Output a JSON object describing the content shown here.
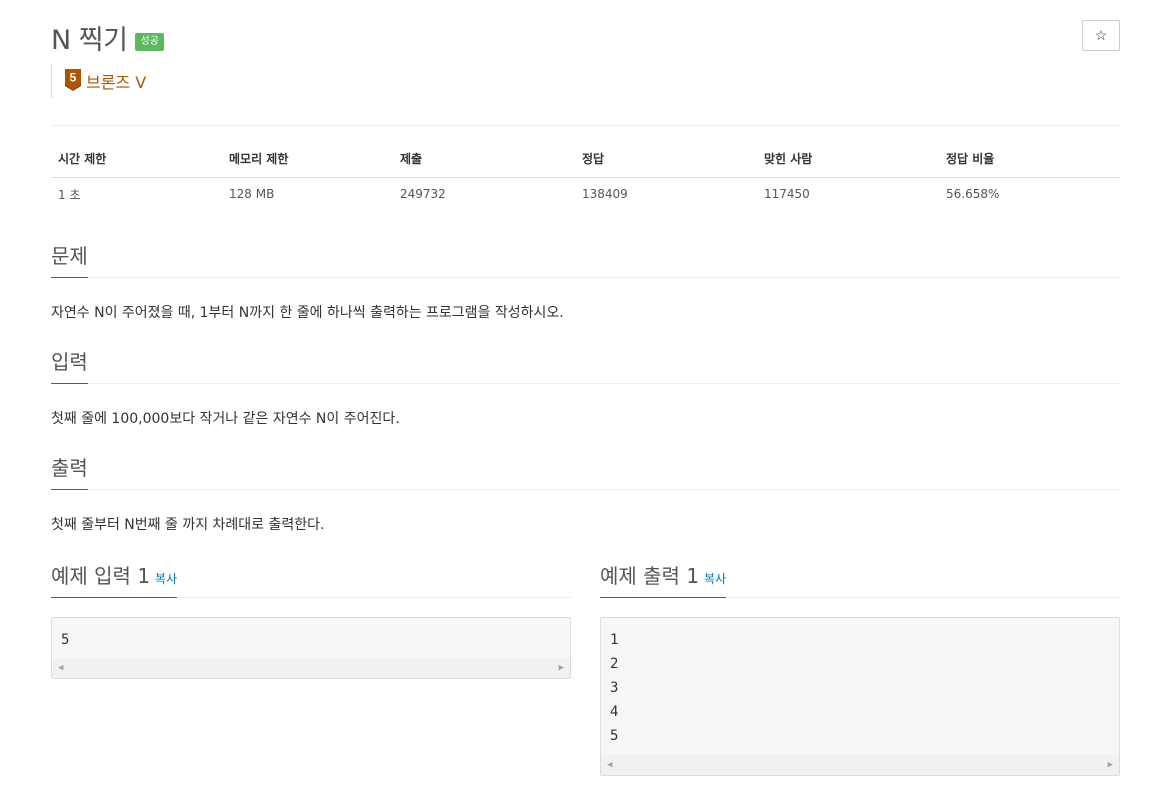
{
  "problem": {
    "title": "N 찍기",
    "status_badge": "성공",
    "star_label": "☆",
    "tier_number": "5",
    "tier_label": "브론즈 V",
    "tier_color": "#ad5600"
  },
  "info_table": {
    "headers": [
      "시간 제한",
      "메모리 제한",
      "제출",
      "정답",
      "맞힌 사람",
      "정답 비율"
    ],
    "values": [
      "1 초",
      "128 MB",
      "249732",
      "138409",
      "117450",
      "56.658%"
    ]
  },
  "sections": {
    "description": {
      "title": "문제",
      "text": "자연수 N이 주어졌을 때, 1부터 N까지 한 줄에 하나씩 출력하는 프로그램을 작성하시오."
    },
    "input": {
      "title": "입력",
      "text": "첫째 줄에 100,000보다 작거나 같은 자연수 N이 주어진다."
    },
    "output": {
      "title": "출력",
      "text": "첫째 줄부터 N번째 줄 까지 차례대로 출력한다."
    }
  },
  "samples": {
    "input": {
      "title": "예제 입력 1",
      "copy_label": "복사",
      "lines": [
        "5"
      ]
    },
    "output": {
      "title": "예제 출력 1",
      "copy_label": "복사",
      "lines": [
        "1",
        "2",
        "3",
        "4",
        "5"
      ]
    }
  },
  "scroll_left_arrow": "◀",
  "scroll_right_arrow": "▶",
  "colors": {
    "success": "#5cb85c",
    "accent": "#0076c0",
    "bronze": "#ad5600"
  }
}
